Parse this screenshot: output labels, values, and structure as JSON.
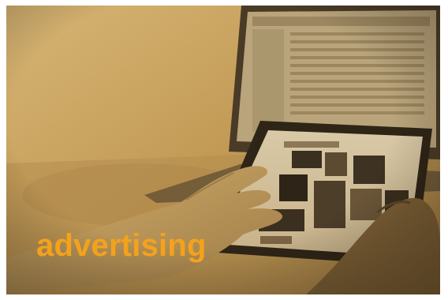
{
  "caption": {
    "text": "advertising"
  },
  "colors": {
    "tint": "#c9a25f",
    "caption": "#f4a21c",
    "dark": "#3e3324"
  },
  "image": {
    "subject": "hands-using-tablet-near-laptop-photo"
  }
}
